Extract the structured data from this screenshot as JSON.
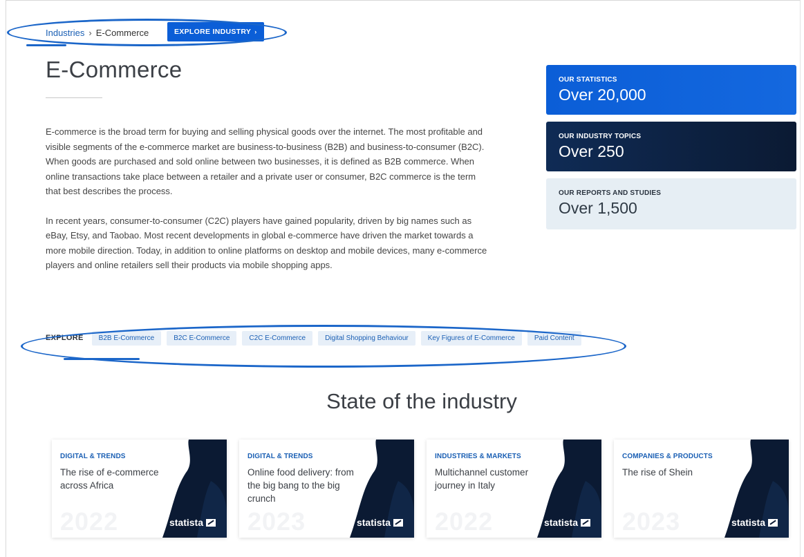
{
  "breadcrumb": {
    "parent": "Industries",
    "separator": "›",
    "current": "E-Commerce"
  },
  "explore_industry_button": "EXPLORE INDUSTRY",
  "explore_industry_arrow": "›",
  "page_title": "E-Commerce",
  "description": [
    "E-commerce is the broad term for buying and selling physical goods over the internet. The most profitable and visible segments of the e-commerce market are business-to-business (B2B) and business-to-consumer (B2C). When goods are purchased and sold online between two businesses, it is defined as B2B commerce. When online transactions take place between a retailer and a private user or consumer, B2C commerce is the term that best describes the process.",
    "In recent years, consumer-to-consumer (C2C) players have gained popularity, driven by big names such as eBay, Etsy, and Taobao. Most recent developments in global e-commerce have driven the market towards a more mobile direction. Today, in addition to online platforms on desktop and mobile devices, many e-commerce players and online retailers sell their products via mobile shopping apps."
  ],
  "stats": [
    {
      "label": "OUR STATISTICS",
      "value": "Over 20,000"
    },
    {
      "label": "OUR INDUSTRY TOPICS",
      "value": "Over 250"
    },
    {
      "label": "OUR REPORTS AND STUDIES",
      "value": "Over 1,500"
    }
  ],
  "explore": {
    "label": "EXPLORE",
    "tags": [
      "B2B E-Commerce",
      "B2C E-Commerce",
      "C2C E-Commerce",
      "Digital Shopping Behaviour",
      "Key Figures of E-Commerce",
      "Paid Content"
    ]
  },
  "section_title": "State of the industry",
  "cards": [
    {
      "category": "DIGITAL & TRENDS",
      "title": "The rise of e-commerce across Africa",
      "year": "2022",
      "brand": "statista"
    },
    {
      "category": "DIGITAL & TRENDS",
      "title": "Online food delivery: from the big bang to the big crunch",
      "year": "2023",
      "brand": "statista"
    },
    {
      "category": "INDUSTRIES & MARKETS",
      "title": "Multichannel customer journey in Italy",
      "year": "2022",
      "brand": "statista"
    },
    {
      "category": "COMPANIES & PRODUCTS",
      "title": "The rise of Shein",
      "year": "2023",
      "brand": "statista"
    }
  ],
  "colors": {
    "accent": "#0b5ed7",
    "dark": "#0b1a33",
    "annotation": "#1b66c9",
    "tag_bg": "#e7eff8"
  }
}
